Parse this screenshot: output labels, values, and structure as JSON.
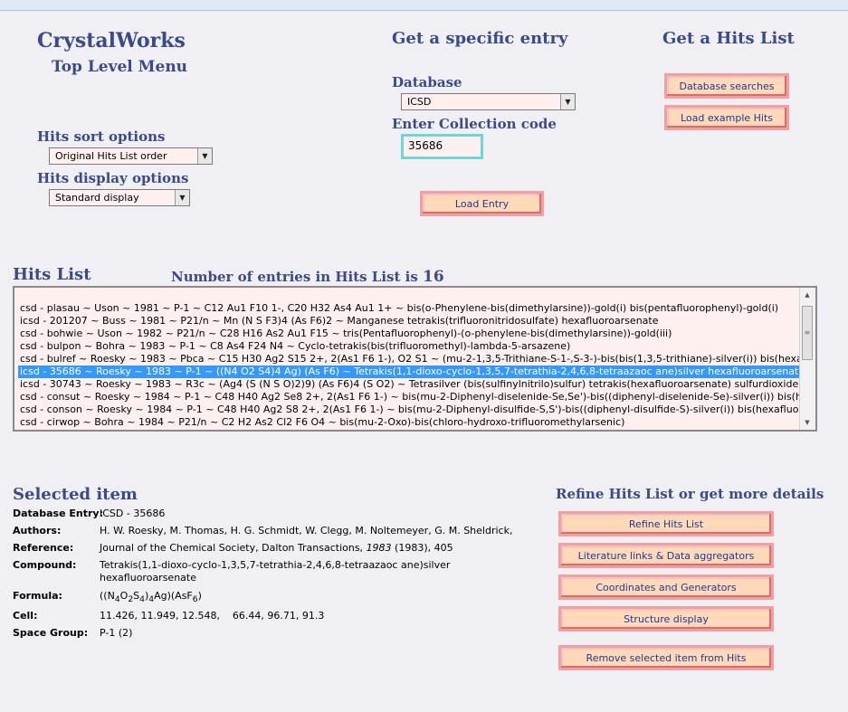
{
  "header": {
    "app_title": "CrystalWorks",
    "subtitle": "Top Level Menu"
  },
  "entry_panel": {
    "title": "Get a specific entry",
    "database_label": "Database",
    "database_value": "ICSD",
    "collection_label": "Enter Collection code",
    "collection_value": "35686",
    "load_button": "Load Entry"
  },
  "hits_panel": {
    "title": "Get a Hits List",
    "database_searches": "Database searches",
    "load_example": "Load example Hits"
  },
  "options": {
    "sort_label": "Hits sort options",
    "sort_value": "Original Hits List order",
    "display_label": "Hits display options",
    "display_value": "Standard display"
  },
  "hits_list": {
    "title": "Hits List",
    "count_text": "Number of entries in Hits List is",
    "count": "16",
    "selected_index": 5,
    "rows": [
      "csd - plasau ~ Uson ~ 1981 ~ P-1 ~ C12 Au1 F10 1-, C20 H32 As4 Au1 1+ ~ bis(o-Phenylene-bis(dimethylarsine))-gold(i) bis(pentafluorophenyl)-gold(i)",
      "icsd - 201207 ~ Buss ~ 1981 ~ P21/n ~ Mn (N S F3)4 (As F6)2 ~ Manganese tetrakis(trifluoronitridosulfate) hexafluoroarsenate",
      "csd - bohwie ~ Uson ~ 1982 ~ P21/n ~ C28 H16 As2 Au1 F15 ~ tris(Pentafluorophenyl)-(o-phenylene-bis(dimethylarsine))-gold(iii)",
      "csd - bulpon ~ Bohra ~ 1983 ~ P-1 ~ C8 As4 F24 N4 ~ Cyclo-tetrakis(bis(trifluoromethyl)-lambda-5-arsazene)",
      "csd - bulref ~ Roesky ~ 1983 ~ Pbca ~ C15 H30 Ag2 S15 2+, 2(As1 F6 1-), O2 S1 ~ (mu-2-1,3,5-Trithiane-S-1-,S-3-)-bis(bis(1,3,5-trithiane)-silver(i)) bis(hexafl",
      "icsd - 35686 ~ Roesky ~ 1983 ~ P-1 ~ ((N4 O2 S4)4 Ag) (As F6) ~ Tetrakis(1,1-dioxo-cyclo-1,3,5,7-tetrathia-2,4,6,8-tetraazaoc ane)silver hexafluoroarsenate",
      "icsd - 30743 ~ Roesky ~ 1983 ~ R3c ~ (Ag4 (S (N S O)2)9) (As F6)4 (S O2) ~ Tetrasilver (bis(sulfinylnitrilo)sulfur) tetrakis(hexafluoroarsenate) sulfurdioxide",
      "csd - consut ~ Roesky ~ 1984 ~ P-1 ~ C48 H40 Ag2 Se8 2+, 2(As1 F6 1-) ~ bis(mu-2-Diphenyl-diselenide-Se,Se')-bis((diphenyl-diselenide-Se)-silver(i)) bis(hexafl",
      "csd - conson ~ Roesky ~ 1984 ~ P-1 ~ C48 H40 Ag2 S8 2+, 2(As1 F6 1-) ~ bis(mu-2-Diphenyl-disulfide-S,S')-bis((diphenyl-disulfide-S)-silver(i)) bis(hexafluoroar",
      "csd - cirwop ~ Bohra ~ 1984 ~ P21/n ~ C2 H2 As2 Cl2 F6 O4 ~ bis(mu-2-Oxo)-bis(chloro-hydroxo-trifluoromethylarsenic)"
    ]
  },
  "selected": {
    "title": "Selected item",
    "database_entry_label": "Database Entry:",
    "database_entry_value": "ICSD - 35686",
    "authors_label": "Authors:",
    "authors_value": "H. W. Roesky, M. Thomas, H. G. Schmidt, W. Clegg, M. Noltemeyer, G. M. Sheldrick,",
    "reference_label": "Reference:",
    "reference_journal": "Journal of the Chemical Society, Dalton Transactions, ",
    "reference_year": "1983",
    "reference_rest": " (1983), 405",
    "compound_label": "Compound:",
    "compound_line1": "Tetrakis(1,1-dioxo-cyclo-1,3,5,7-tetrathia-2,4,6,8-tetraazaoc ane)silver",
    "compound_line2": "hexafluoroarsenate",
    "formula_label": "Formula:",
    "formula_parts": [
      "((N",
      "4",
      "O",
      "2",
      "S",
      "4",
      ")",
      "4",
      "Ag)(AsF",
      "6",
      ")"
    ],
    "cell_label": "Cell:",
    "cell_value": "11.426, 11.949, 12.548,    66.44, 96.71, 91.3",
    "space_group_label": "Space Group:",
    "space_group_value": "P-1 (2)"
  },
  "refine_panel": {
    "title": "Refine Hits List or get more details",
    "buttons": [
      "Refine Hits List",
      "Literature links & Data aggregators",
      "Coordinates and Generators",
      "Structure display",
      "Remove selected item from Hits"
    ]
  }
}
